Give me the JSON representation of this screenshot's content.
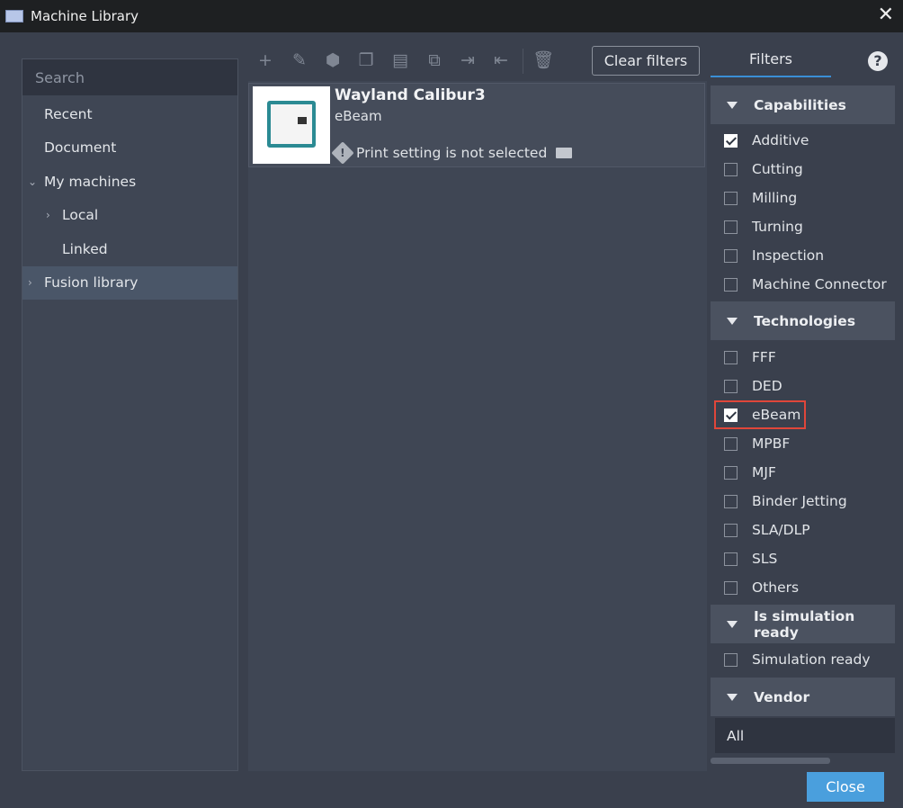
{
  "window": {
    "title": "Machine Library"
  },
  "sidebar": {
    "search_placeholder": "Search",
    "items": [
      {
        "label": "Recent"
      },
      {
        "label": "Document"
      },
      {
        "label": "My machines"
      },
      {
        "label": "Local"
      },
      {
        "label": "Linked"
      },
      {
        "label": "Fusion library"
      }
    ]
  },
  "toolbar": {
    "icons": [
      "add-icon",
      "edit-icon",
      "box-icon",
      "copy-icon",
      "paste-icon",
      "duplicate-icon",
      "import-icon",
      "export-icon",
      "delete-icon"
    ],
    "clear_filters": "Clear filters"
  },
  "machines": [
    {
      "name": "Wayland Calibur3",
      "technology": "eBeam",
      "status": "Print setting is not selected"
    }
  ],
  "filters": {
    "tab": "Filters",
    "help": "?",
    "sections": [
      {
        "title": "Capabilities",
        "items": [
          {
            "label": "Additive",
            "checked": true
          },
          {
            "label": "Cutting",
            "checked": false
          },
          {
            "label": "Milling",
            "checked": false
          },
          {
            "label": "Turning",
            "checked": false
          },
          {
            "label": "Inspection",
            "checked": false
          },
          {
            "label": "Machine Connector",
            "checked": false
          }
        ]
      },
      {
        "title": "Technologies",
        "items": [
          {
            "label": "FFF",
            "checked": false
          },
          {
            "label": "DED",
            "checked": false
          },
          {
            "label": "eBeam",
            "checked": true
          },
          {
            "label": "MPBF",
            "checked": false
          },
          {
            "label": "MJF",
            "checked": false
          },
          {
            "label": "Binder Jetting",
            "checked": false
          },
          {
            "label": "SLA/DLP",
            "checked": false
          },
          {
            "label": "SLS",
            "checked": false
          },
          {
            "label": "Others",
            "checked": false
          }
        ]
      },
      {
        "title": "Is simulation ready",
        "items": [
          {
            "label": "Simulation ready",
            "checked": false
          }
        ]
      },
      {
        "title": "Vendor",
        "value": "All"
      }
    ]
  },
  "footer": {
    "close": "Close"
  }
}
